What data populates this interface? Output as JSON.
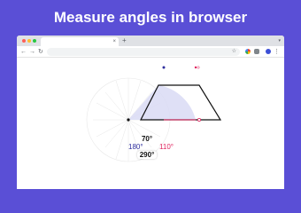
{
  "headline": "Measure angles in browser",
  "browser": {
    "tab_close_glyph": "×",
    "new_tab_glyph": "+",
    "tab_menu_glyph": "▾",
    "nav": {
      "back": "←",
      "forward": "→",
      "reload": "↻"
    },
    "star_glyph": "☆",
    "menu_glyph": "⋮",
    "traffic_lights": [
      "#ff5f57",
      "#febc2e",
      "#28c840"
    ]
  },
  "readout": {
    "top_angle": "70°",
    "left_angle": "180°",
    "right_angle": "110°",
    "bottom_angle": "290°"
  },
  "colors": {
    "background": "#5a4fd6",
    "angle_primary": "#2f2f9e",
    "angle_secondary": "#e0245e",
    "sector_fill": "#d9dbf5"
  },
  "icons": [
    "close-icon",
    "plus-icon",
    "chevron-down-icon",
    "back-arrow-icon",
    "forward-arrow-icon",
    "reload-icon",
    "star-icon",
    "extension-icon",
    "puzzle-icon",
    "profile-icon",
    "more-vert-icon"
  ]
}
